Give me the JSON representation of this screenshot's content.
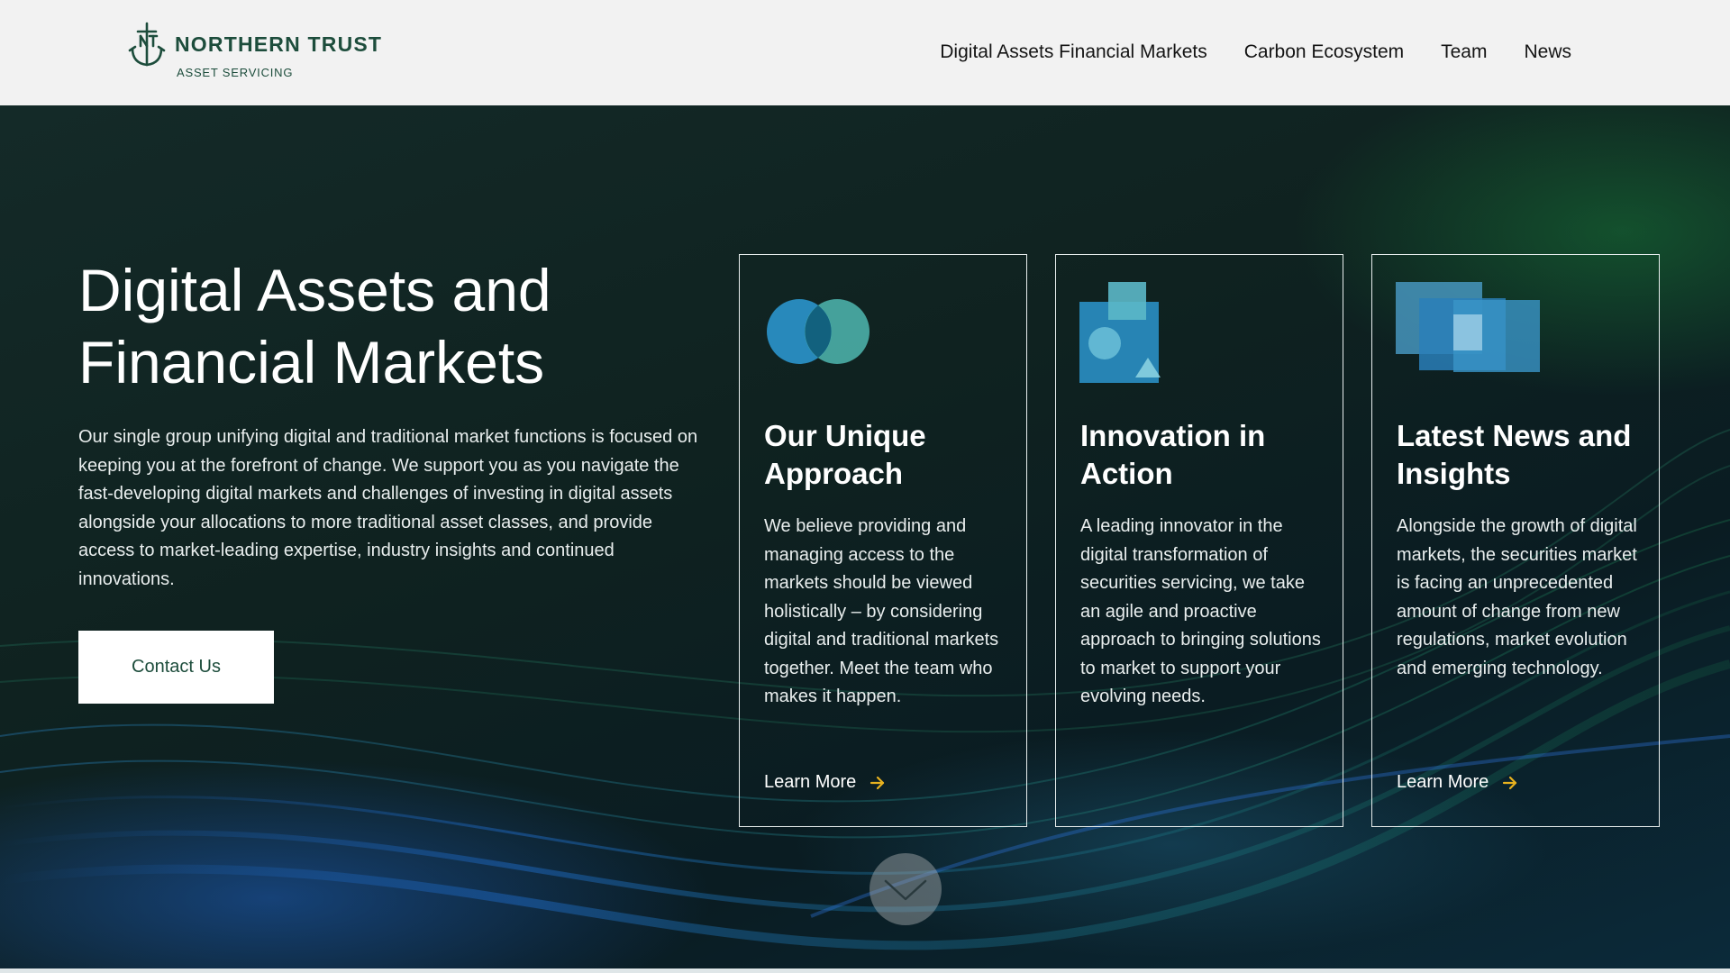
{
  "header": {
    "logo": {
      "name": "NORTHERN TRUST",
      "sub": "ASSET SERVICING"
    },
    "nav": [
      {
        "label": "Digital Assets Financial Markets"
      },
      {
        "label": "Carbon Ecosystem"
      },
      {
        "label": "Team"
      },
      {
        "label": "News"
      }
    ]
  },
  "hero": {
    "title_line1": "Digital Assets and",
    "title_line2": "Financial Markets",
    "description": "Our single group unifying digital and traditional market functions is focused on keeping you at the forefront of change. We support you as you navigate the fast-developing digital markets and challenges of investing in digital assets alongside your allocations to more traditional asset classes, and provide access to market-leading expertise, industry insights and continued innovations.",
    "cta_label": "Contact Us"
  },
  "cards": [
    {
      "icon": "overlapping-circles-icon",
      "title": "Our Unique Approach",
      "text": "We believe providing and managing access to the markets should be viewed holistically – by considering digital and traditional markets together. Meet the team who makes it happen.",
      "link_label": "Learn More"
    },
    {
      "icon": "shapes-icon",
      "title": "Innovation in Action",
      "text": "A leading innovator in the digital transformation of securities servicing, we take an agile and proactive approach to bringing solutions to market to support your evolving needs."
    },
    {
      "icon": "overlapping-squares-icon",
      "title": "Latest News and Insights",
      "text": "Alongside the growth of digital markets, the securities market is facing an unprecedented amount of change from new regulations, market evolution and emerging technology.",
      "link_label": "Learn More"
    }
  ],
  "colors": {
    "brand_green": "#1d4d3c",
    "arrow_accent": "#e8b21f",
    "icon_blue": "#2a8fc4",
    "icon_teal": "#4fb7b0"
  },
  "scroll_icon": "chevron-down-icon"
}
